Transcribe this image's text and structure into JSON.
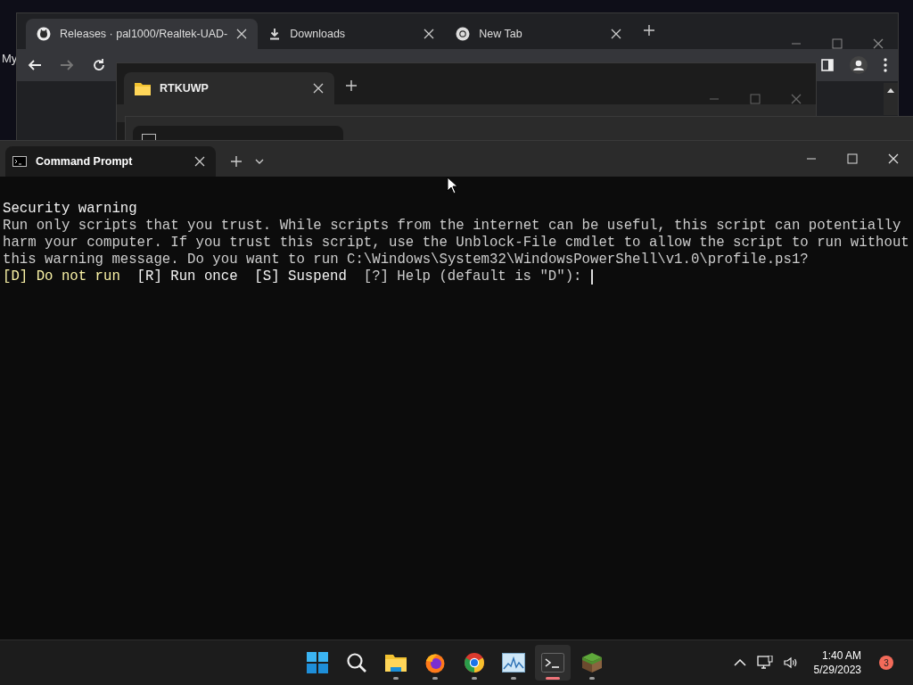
{
  "desktop": {
    "label": "My"
  },
  "browser": {
    "tabs": [
      {
        "kind": "github",
        "title": "Releases · pal1000/Realtek-UAD-",
        "selected": true
      },
      {
        "kind": "download",
        "title": "Downloads",
        "selected": false
      },
      {
        "kind": "chrome",
        "title": "New Tab",
        "selected": false
      }
    ]
  },
  "explorer": {
    "tab": {
      "title": "RTKUWP"
    }
  },
  "terminal": {
    "tab": {
      "title": "Command Prompt"
    },
    "lines": [
      [
        {
          "kind": "heading",
          "text": "Security warning"
        }
      ],
      [
        {
          "kind": "body",
          "text": "Run only scripts that you trust. While scripts from the internet can be useful, this script can potentially"
        }
      ],
      [
        {
          "kind": "body",
          "text": "harm your computer. If you trust this script, use the Unblock-File cmdlet to allow the script to run without"
        }
      ],
      [
        {
          "kind": "body",
          "text": "this warning message. Do you want to run C:\\Windows\\System32\\WindowsPowerShell\\v1.0\\profile.ps1?"
        }
      ],
      [
        {
          "kind": "default",
          "text": "[D] Do not run"
        },
        {
          "kind": "option",
          "text": "[R] Run once"
        },
        {
          "kind": "option",
          "text": "[S] Suspend"
        },
        {
          "kind": "body",
          "text": "[?] Help (default is \"D\"): "
        }
      ]
    ]
  },
  "taskbar": {
    "apps": [
      {
        "kind": "start",
        "open": false,
        "focused": false
      },
      {
        "kind": "search",
        "open": false,
        "focused": false
      },
      {
        "kind": "folder",
        "open": true,
        "focused": false
      },
      {
        "kind": "firefox",
        "open": true,
        "focused": false
      },
      {
        "kind": "chrome",
        "open": true,
        "focused": false
      },
      {
        "kind": "monitor",
        "open": true,
        "focused": false
      },
      {
        "kind": "terminal",
        "open": true,
        "focused": true
      },
      {
        "kind": "block",
        "open": true,
        "focused": false
      }
    ],
    "time": "1:40 AM",
    "date": "5/29/2023",
    "notifications": "3"
  }
}
